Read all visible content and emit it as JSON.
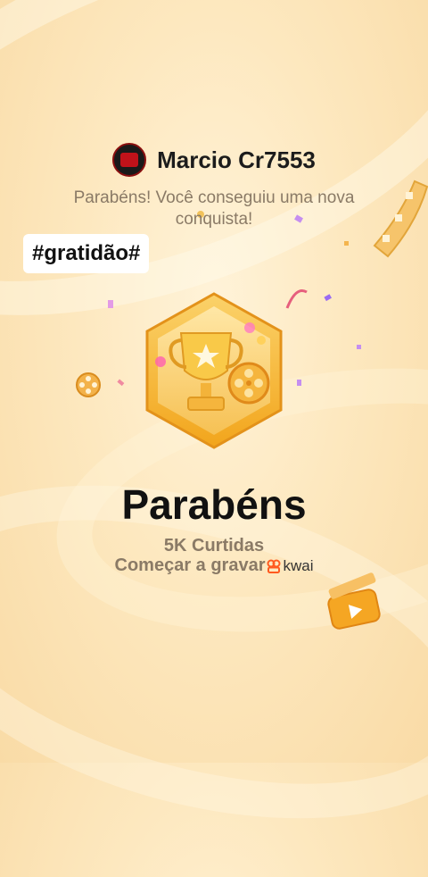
{
  "user": {
    "name": "Marcio Cr7553"
  },
  "subtitle": "Parabéns! Você conseguiu uma nova conquista!",
  "hashtag": "#gratidão#",
  "achievement": {
    "title": "Parabéns",
    "likes": "5K Curtidas",
    "record_text": "Começar a gravar",
    "brand": "kwai"
  },
  "colors": {
    "accent": "#f2a51c",
    "brand": "#ff5a1f"
  }
}
